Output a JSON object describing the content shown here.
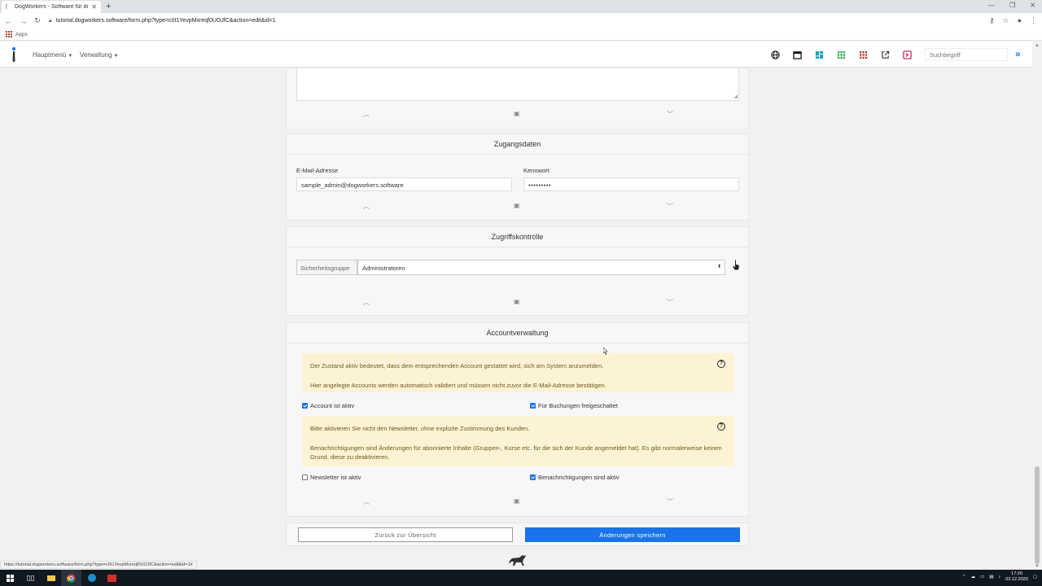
{
  "browser": {
    "tab_title": "DogWorkers - Software für die H",
    "url": "tutorial.dogworkers.software/form.php?type=c0I1YevpMxreqf0UOJfC&action=edit&id=1",
    "bookmarks_label": "Apps",
    "status_url": "https://tutorial.dogworkers.software/form.php?type=c0I1YevpMxreqf0UOJfC&action=edit&id=1#"
  },
  "nav": {
    "menu_main": "Hauptmenü",
    "menu_admin": "Verwaltung",
    "search_placeholder": "Suchbegriff"
  },
  "zugang": {
    "title": "Zugangsdaten",
    "email_label": "E-Mail-Adresse",
    "email_value": "sample_admin@dogworkers.software",
    "password_label": "Kennwort",
    "password_value": "•••••••••"
  },
  "zugriff": {
    "title": "Zugriffskontrolle",
    "group_label": "Sicherheitsgruppe",
    "group_value": "Administratoren"
  },
  "account": {
    "title": "Accountverwaltung",
    "info1_line1": "Der Zustand aktiv bedeutet, dass dem entsprechenden Account gestattet wird, sich am System anzumelden.",
    "info1_line2": "Hier angelegte Accounts werden automatisch validiert und müssen nicht zuvor die E-Mail-Adresse bestätigen.",
    "chk_active": "Account ist aktiv",
    "chk_bookings": "Für Buchungen freigeschaltet",
    "info2_line1": "Bitte aktivieren Sie nicht den Newsletter, ohne explizite Zustimmung des Kunden.",
    "info2_line2": "Benachrichtigungen sind Änderungen für abonnierte Inhalte (Gruppen-, Kurse etc. für die sich der Kunde angemeldet hat). Es gibt normalerweise keinen Grund, diese zu deaktivieren.",
    "chk_newsletter": "Newsletter ist aktiv",
    "chk_notifications": "Benachrichtigungen sind aktiv"
  },
  "buttons": {
    "back": "Zurück zur Übersicht",
    "save": "Änderungen speichern"
  },
  "taskbar": {
    "time": "17:20",
    "date": "02.12.2020"
  }
}
